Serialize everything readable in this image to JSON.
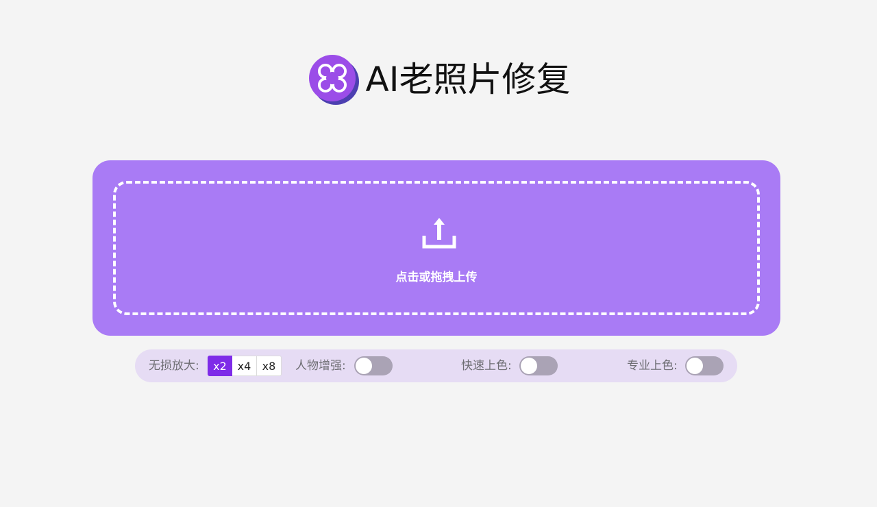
{
  "header": {
    "title": "AI老照片修复",
    "logo_icon": "flower-logo-icon"
  },
  "upload": {
    "icon": "upload-icon",
    "label": "点击或拖拽上传"
  },
  "options": {
    "scale": {
      "label": "无损放大:",
      "options": [
        "x2",
        "x4",
        "x8"
      ],
      "selected": "x2"
    },
    "face_enhance": {
      "label": "人物增强:",
      "enabled": false
    },
    "fast_colorize": {
      "label": "快速上色:",
      "enabled": false
    },
    "pro_colorize": {
      "label": "专业上色:",
      "enabled": false
    }
  },
  "colors": {
    "background": "#f4f4f4",
    "upload_card": "#a97bf5",
    "options_bar": "#e6dcf4",
    "accent": "#7e2be8",
    "toggle_off": "#aaa3b5"
  }
}
